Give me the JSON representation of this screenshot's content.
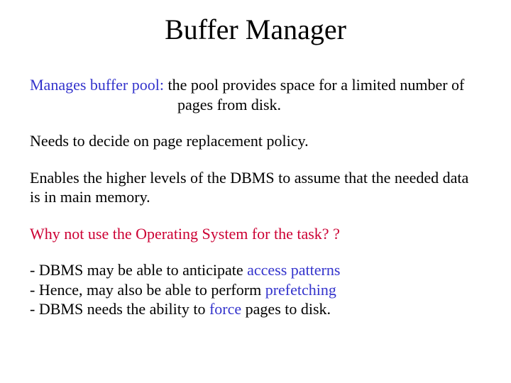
{
  "title": "Buffer Manager",
  "p1_lead": "Manages buffer pool:",
  "p1_rest": "  the pool provides space for a limited number of pages from disk.",
  "p2": "Needs to decide on page replacement policy.",
  "p3": "Enables the higher levels of the DBMS to assume that the needed data is in main memory.",
  "p4": "Why not use the Operating System for the task? ?",
  "b1_a": "- DBMS may be able to anticipate ",
  "b1_b": "access patterns",
  "b2_a": "- Hence, may also be able to perform ",
  "b2_b": "prefetching",
  "b3_a": "- DBMS needs the ability to ",
  "b3_b": "force",
  "b3_c": " pages to disk."
}
